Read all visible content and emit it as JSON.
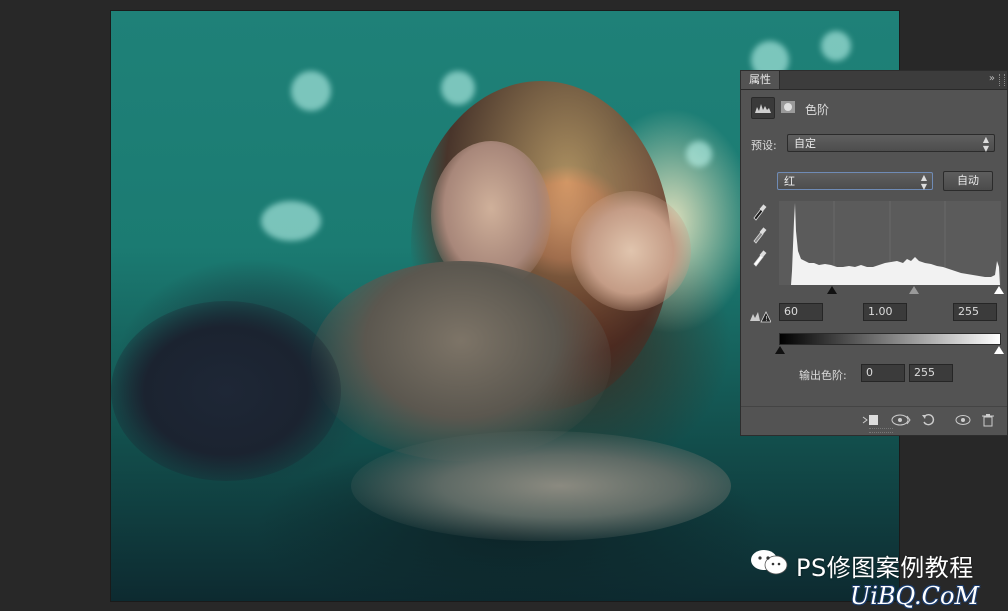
{
  "panel": {
    "tab_label": "属性",
    "menu_icon": "double-chevron-icon",
    "adjustment_title": "色阶",
    "preset_label": "预设:",
    "preset_value": "自定",
    "channel_value": "红",
    "auto_label": "自动",
    "input_black": "60",
    "input_gamma": "1.00",
    "input_white": "255",
    "output_label": "输出色阶:",
    "output_black": "0",
    "output_white": "255",
    "footer_icons": [
      "clip-to-layer-icon",
      "view-previous-icon",
      "reset-icon",
      "visibility-icon",
      "trash-icon"
    ]
  },
  "watermark": {
    "brand": "PS修图案例教程",
    "site": "UiBQ.CoM"
  },
  "colors": {
    "panel_bg": "#535353",
    "workspace_bg": "#282828",
    "photo_teal": "#1f8178"
  }
}
